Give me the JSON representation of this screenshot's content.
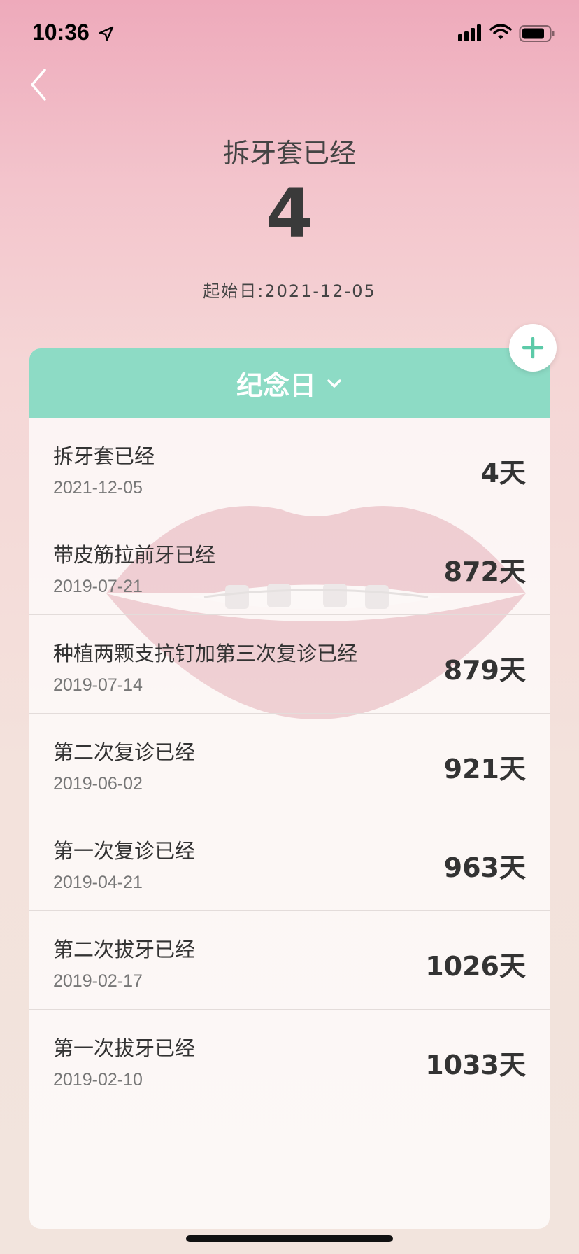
{
  "status_bar": {
    "time": "10:36"
  },
  "header": {
    "title": "拆牙套已经",
    "count": "4",
    "start_date": "起始日:2021-12-05"
  },
  "card": {
    "tab_label": "纪念日",
    "accent_color": "#8ddbc5"
  },
  "items": [
    {
      "title": "拆牙套已经",
      "date": "2021-12-05",
      "days": "4天"
    },
    {
      "title": "带皮筋拉前牙已经",
      "date": "2019-07-21",
      "days": "872天"
    },
    {
      "title": "种植两颗支抗钉加第三次复诊已经",
      "date": "2019-07-14",
      "days": "879天"
    },
    {
      "title": "第二次复诊已经",
      "date": "2019-06-02",
      "days": "921天"
    },
    {
      "title": "第一次复诊已经",
      "date": "2019-04-21",
      "days": "963天"
    },
    {
      "title": "第二次拔牙已经",
      "date": "2019-02-17",
      "days": "1026天"
    },
    {
      "title": "第一次拔牙已经",
      "date": "2019-02-10",
      "days": "1033天"
    }
  ],
  "icons": {
    "back": "back-chevron-icon",
    "add": "plus-icon",
    "dropdown": "chevron-down-icon"
  }
}
